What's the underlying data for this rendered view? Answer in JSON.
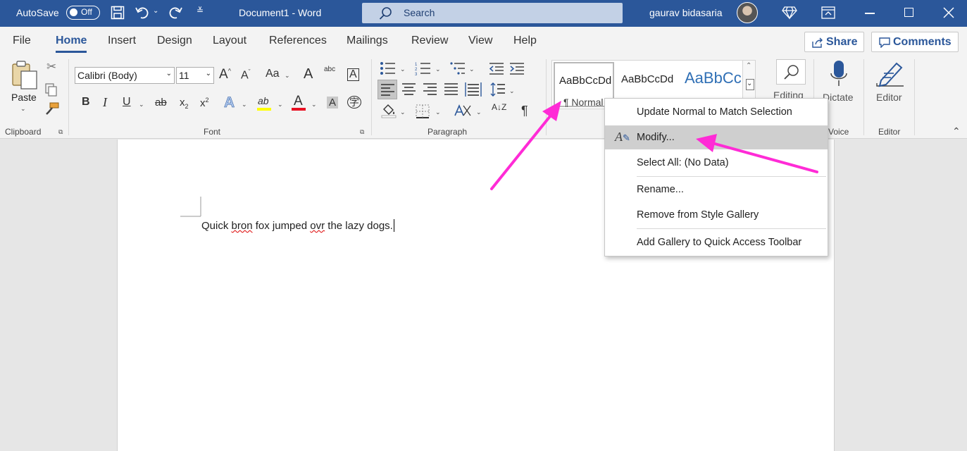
{
  "titlebar": {
    "autosave_label": "AutoSave",
    "autosave_state": "Off",
    "doc_title": "Document1  -  Word",
    "search_placeholder": "Search",
    "user_name": "gaurav bidasaria"
  },
  "tabs": [
    "File",
    "Home",
    "Insert",
    "Design",
    "Layout",
    "References",
    "Mailings",
    "Review",
    "View",
    "Help"
  ],
  "active_tab": "Home",
  "share_label": "Share",
  "comments_label": "Comments",
  "ribbon": {
    "clipboard": {
      "paste_label": "Paste",
      "group_label": "Clipboard"
    },
    "font": {
      "font_name": "Calibri (Body)",
      "font_size": "11",
      "group_label": "Font",
      "change_case": "Aa",
      "bold": "B",
      "italic": "I",
      "underline": "U",
      "strike": "ab",
      "subscript": "x",
      "superscript": "x",
      "grow": "A",
      "shrink": "A",
      "clear_format": "A",
      "phonetic": "abc",
      "char_border": "A",
      "text_effects": "A",
      "highlight": "ab",
      "font_color": "A",
      "shading": "A",
      "enclose": "字"
    },
    "paragraph": {
      "group_label": "Paragraph",
      "pilcrow": "¶",
      "sort": "A↓Z"
    },
    "styles": {
      "item1_preview": "AaBbCcDd",
      "item1_name": "¶ Normal",
      "item2_preview": "AaBbCcDd",
      "item3_preview": "AaBbCc"
    },
    "editing_label": "Editing",
    "dictate_label": "Dictate",
    "voice_group": "Voice",
    "editor_label": "Editor",
    "editor_group": "Editor"
  },
  "document": {
    "w1": "Quick ",
    "w2": "bron",
    "w3": " fox jumped ",
    "w4": "ovr",
    "w5": " the lazy dogs."
  },
  "context_menu": [
    {
      "label": "Update Normal to Match Selection"
    },
    {
      "label": "Modify..."
    },
    {
      "label": "Select All: (No Data)"
    },
    {
      "label": "Rename..."
    },
    {
      "label": "Remove from Style Gallery"
    },
    {
      "label": "Add Gallery to Quick Access Toolbar"
    }
  ],
  "colors": {
    "title_bar": "#2b579a",
    "accent": "#2b579a",
    "arrow": "#ff2bd6",
    "highlight_yellow": "#ffff00",
    "font_red": "#e81123"
  }
}
